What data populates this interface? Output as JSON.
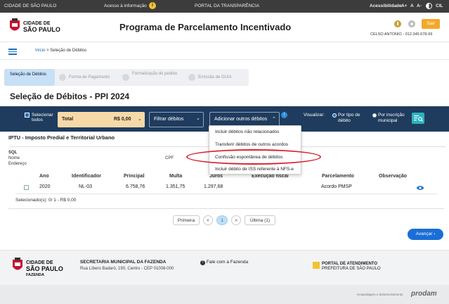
{
  "topbar": {
    "city": "CIDADE DE SÃO PAULO",
    "access_info": "Acesso à informação",
    "transparency": "PORTAL DA TRANSPARÊNCIA",
    "accessibility": "Acessibilidade",
    "font_plus": "A+",
    "font_normal": "A",
    "font_minus": "A-",
    "contrast_icon": "contrast-icon",
    "cil": "CIL"
  },
  "header": {
    "logo_line1": "CIDADE DE",
    "logo_line2": "SÃO PAULO",
    "title": "Programa de Parcelamento Incentivado",
    "sair": "Sair",
    "user": "CELSO ANTONIO - 012.345.678-99"
  },
  "breadcrumb": {
    "home": "Início",
    "separator": ">",
    "current": "Seleção de Débitos"
  },
  "stepper": {
    "steps": [
      {
        "label": "Seleção de Débitos",
        "active": true
      },
      {
        "label": "Forma de Pagamento",
        "active": false
      },
      {
        "label": "Formalização do pedido",
        "active": false
      },
      {
        "label": "Emissão de GUIA",
        "active": false
      }
    ]
  },
  "page_title": "Seleção de Débitos - PPI 2024",
  "filterbar": {
    "select_all": "Selecionar todos",
    "total_label": "Total",
    "total_value": "R$ 0,00",
    "filter_label": "Filtrar débitos",
    "add_label": "Adicionar outros débitos",
    "view_label": "Visualizar:",
    "opt_tipo": "Por tipo de débito",
    "opt_inscricao": "Por inscrição municipal"
  },
  "dropdown_menu": {
    "items": [
      "Incluir débitos não relacionados",
      "Transferir débitos de outros acordos",
      "Confissão espontânea de débitos",
      "Incluir débito de ISS referente à NFS-e"
    ],
    "highlighted_index": 2
  },
  "section": {
    "title": "IPTU - Imposto Predial e Territorial Urbano",
    "sql": "SQL",
    "nome": "Nome",
    "endereco": "Endereço",
    "cpf_partial": "CPF"
  },
  "table": {
    "headers": [
      "Ano",
      "Identificador",
      "Principal",
      "Multa",
      "Juros",
      "Execução fiscal",
      "Parcelamento",
      "Observação"
    ],
    "rows": [
      {
        "ano": "2020",
        "identificador": "NL-03",
        "principal": "6.758,76",
        "multa": "1.351,75",
        "juros": "1.297,68",
        "execucao": "",
        "parcelamento": "Acordo PMSP"
      }
    ],
    "selected_info": "Selecionado(s): 0/ 1 - R$ 0,00"
  },
  "pagination": {
    "first": "Primeira",
    "prev": "<",
    "current": "1",
    "next": ">",
    "last": "Última (1)"
  },
  "advance_button": "Avançar",
  "footer": {
    "logo_line1": "CIDADE DE",
    "logo_line2": "SÃO PAULO",
    "logo_line3": "FAZENDA",
    "secretaria": "SECRETARIA MUNICIPAL DA FAZENDA",
    "address": "Rua Líbero Badaró, 190, Centro - CEP 01008-000",
    "contact": "Fale com a Fazenda",
    "portal_line1": "PORTAL DE ATENDIMENTO",
    "portal_line2": "PREFEITURA DE SÃO PAULO"
  },
  "bottom": {
    "hosted": "Hospedagem e desenvolvimento",
    "prodam": "prodam"
  },
  "colors": {
    "topbar": "#3c3c3c",
    "filterbar": "#1f3c5e",
    "accent": "#1a6ed8",
    "total_bg": "#f7d9a7",
    "sair": "#f2a829",
    "highlight": "#d8202a"
  }
}
